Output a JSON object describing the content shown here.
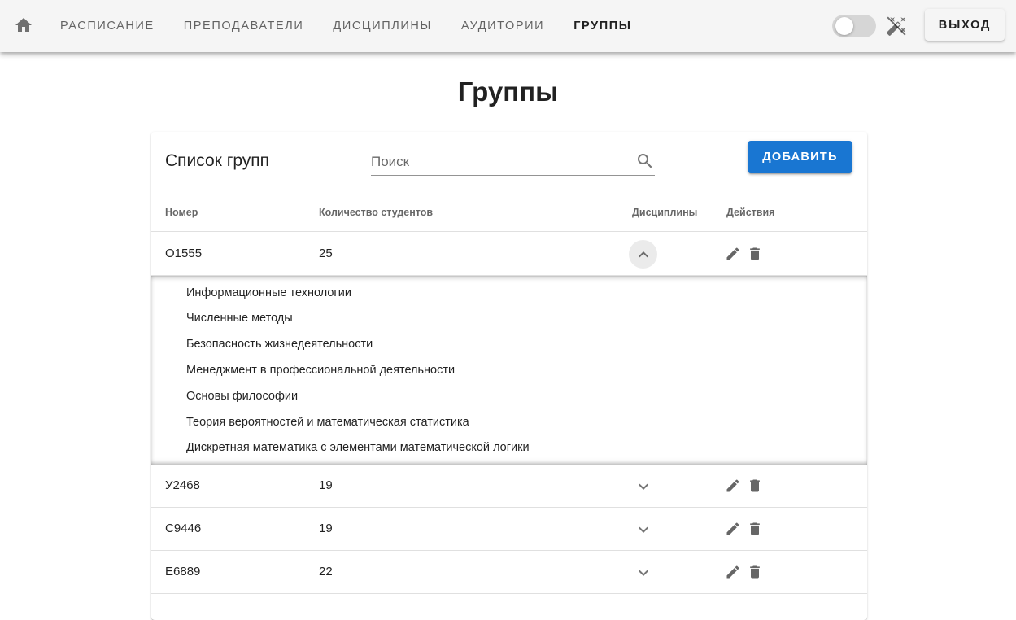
{
  "nav": {
    "home_icon": "home-icon",
    "items": [
      {
        "label": "Расписание",
        "active": false
      },
      {
        "label": "Преподаватели",
        "active": false
      },
      {
        "label": "Дисциплины",
        "active": false
      },
      {
        "label": "Аудитории",
        "active": false
      },
      {
        "label": "Группы",
        "active": true
      }
    ],
    "theme_toggle_on": false,
    "theme_icon": "invert-colors-off-icon",
    "logout_label": "Выход"
  },
  "page": {
    "title": "Группы"
  },
  "card": {
    "title": "Список групп",
    "search_placeholder": "Поиск",
    "search_value": "",
    "add_label": "Добавить",
    "accent": "#1976d2"
  },
  "table": {
    "headers": {
      "number": "Номер",
      "count": "Количество студентов",
      "disciplines": "Дисциплины",
      "actions": "Действия"
    },
    "rows": [
      {
        "number": "О1555",
        "count": "25",
        "expanded": true,
        "disciplines": [
          "Информационные технологии",
          "Численные методы",
          "Безопасность жизнедеятельности",
          "Менеджмент в профессиональной деятельности",
          "Основы философии",
          "Теория вероятностей и математическая статистика",
          "Дискретная математика с элементами математической логики"
        ]
      },
      {
        "number": "У2468",
        "count": "19",
        "expanded": false
      },
      {
        "number": "С9446",
        "count": "19",
        "expanded": false
      },
      {
        "number": "Е6889",
        "count": "22",
        "expanded": false
      }
    ]
  }
}
